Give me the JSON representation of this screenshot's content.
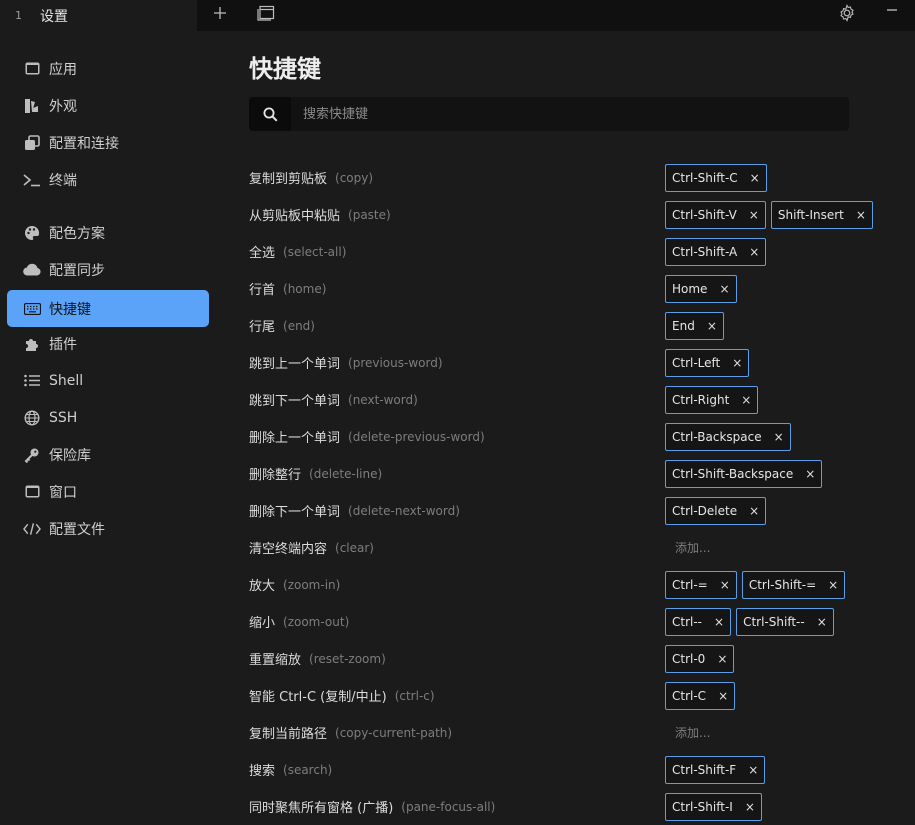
{
  "titlebar": {
    "tab_index": "1",
    "tab_title": "设置",
    "new_tab_icon": "plus-icon",
    "window_icon": "window-icon",
    "settings_icon": "gear-icon",
    "minimize_icon": "minimize-icon"
  },
  "sidebar": {
    "items": [
      {
        "label": "应用",
        "icon": "app-window-icon"
      },
      {
        "label": "外观",
        "icon": "paint-brush-icon"
      },
      {
        "label": "配置和连接",
        "icon": "profiles-icon"
      },
      {
        "label": "终端",
        "icon": "terminal-icon"
      },
      {
        "label": "配色方案",
        "icon": "palette-icon"
      },
      {
        "label": "配置同步",
        "icon": "cloud-icon"
      },
      {
        "label": "快捷键",
        "icon": "keyboard-icon"
      },
      {
        "label": "插件",
        "icon": "puzzle-icon"
      },
      {
        "label": "Shell",
        "icon": "list-icon"
      },
      {
        "label": "SSH",
        "icon": "globe-icon"
      },
      {
        "label": "保险库",
        "icon": "key-icon"
      },
      {
        "label": "窗口",
        "icon": "window-icon"
      },
      {
        "label": "配置文件",
        "icon": "code-icon"
      }
    ],
    "active": "快捷键"
  },
  "main": {
    "title": "快捷键",
    "search": {
      "placeholder": "搜索快捷键"
    },
    "add_label": "添加...",
    "hotkeys": [
      {
        "name": "复制到剪贴板",
        "id": "(copy)",
        "keys": [
          "Ctrl-Shift-C"
        ]
      },
      {
        "name": "从剪贴板中粘贴",
        "id": "(paste)",
        "keys": [
          "Ctrl-Shift-V",
          "Shift-Insert"
        ]
      },
      {
        "name": "全选",
        "id": "(select-all)",
        "keys": [
          "Ctrl-Shift-A"
        ]
      },
      {
        "name": "行首",
        "id": "(home)",
        "keys": [
          "Home"
        ]
      },
      {
        "name": "行尾",
        "id": "(end)",
        "keys": [
          "End"
        ]
      },
      {
        "name": "跳到上一个单词",
        "id": "(previous-word)",
        "keys": [
          "Ctrl-Left"
        ]
      },
      {
        "name": "跳到下一个单词",
        "id": "(next-word)",
        "keys": [
          "Ctrl-Right"
        ]
      },
      {
        "name": "删除上一个单词",
        "id": "(delete-previous-word)",
        "keys": [
          "Ctrl-Backspace"
        ]
      },
      {
        "name": "删除整行",
        "id": "(delete-line)",
        "keys": [
          "Ctrl-Shift-Backspace"
        ]
      },
      {
        "name": "删除下一个单词",
        "id": "(delete-next-word)",
        "keys": [
          "Ctrl-Delete"
        ]
      },
      {
        "name": "清空终端内容",
        "id": "(clear)",
        "keys": []
      },
      {
        "name": "放大",
        "id": "(zoom-in)",
        "keys": [
          "Ctrl-=",
          "Ctrl-Shift-="
        ]
      },
      {
        "name": "缩小",
        "id": "(zoom-out)",
        "keys": [
          "Ctrl--",
          "Ctrl-Shift--"
        ]
      },
      {
        "name": "重置缩放",
        "id": "(reset-zoom)",
        "keys": [
          "Ctrl-0"
        ]
      },
      {
        "name": "智能 Ctrl-C (复制/中止)",
        "id": "(ctrl-c)",
        "keys": [
          "Ctrl-C"
        ]
      },
      {
        "name": "复制当前路径",
        "id": "(copy-current-path)",
        "keys": []
      },
      {
        "name": "搜索",
        "id": "(search)",
        "keys": [
          "Ctrl-Shift-F"
        ]
      },
      {
        "name": "同时聚焦所有窗格 (广播)",
        "id": "(pane-focus-all)",
        "keys": [
          "Ctrl-Shift-I"
        ]
      }
    ]
  }
}
